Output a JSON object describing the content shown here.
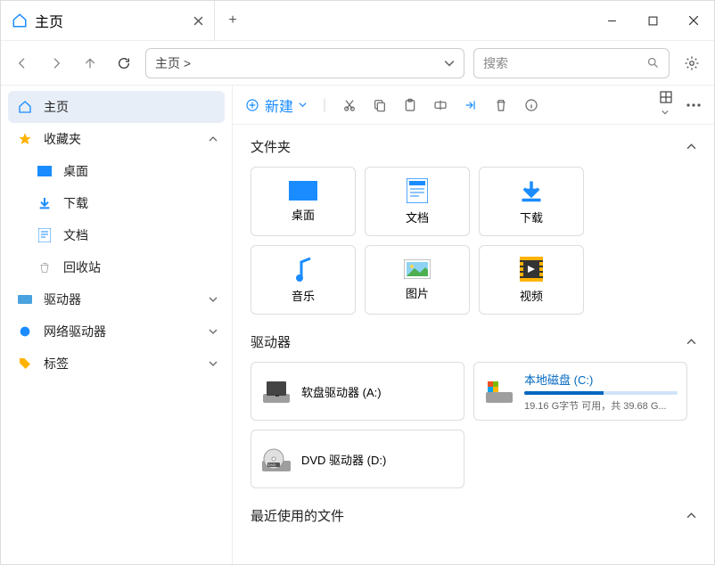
{
  "window": {
    "title": "主页"
  },
  "toolbar": {
    "address": "主页 >",
    "search_placeholder": "搜索"
  },
  "sidebar": {
    "home": "主页",
    "favorites": "收藏夹",
    "fav_items": {
      "desktop": "桌面",
      "downloads": "下载",
      "documents": "文档",
      "recycle": "回收站"
    },
    "drives": "驱动器",
    "network": "网络驱动器",
    "tags": "标签"
  },
  "cmdbar": {
    "new": "新建"
  },
  "sections": {
    "folders": "文件夹",
    "drives": "驱动器",
    "recent": "最近使用的文件"
  },
  "folders": {
    "desktop": "桌面",
    "documents": "文档",
    "downloads": "下载",
    "music": "音乐",
    "pictures": "图片",
    "videos": "视频"
  },
  "drives_list": {
    "floppy": "软盘驱动器 (A:)",
    "local": {
      "name": "本地磁盘 (C:)",
      "stat": "19.16 G字节 可用，共 39.68 G...",
      "pct": 52
    },
    "dvd": "DVD 驱动器 (D:)"
  }
}
